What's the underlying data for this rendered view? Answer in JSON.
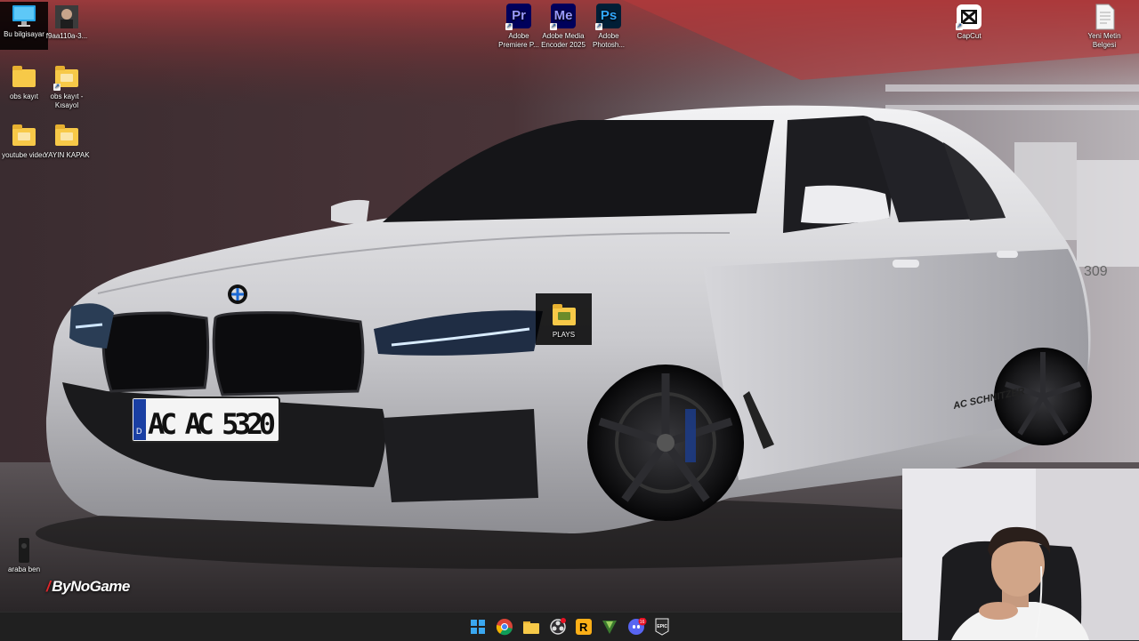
{
  "desktop": {
    "icons": [
      {
        "label": "Bu bilgisayar",
        "icon": "monitor-icon"
      },
      {
        "label": "f9aa110a-3...",
        "icon": "photo-icon"
      },
      {
        "label": "obs kayıt",
        "icon": "folder-icon"
      },
      {
        "label": "obs kayıt - Kısayol",
        "icon": "folder-shortcut-icon"
      },
      {
        "label": "youtube video",
        "icon": "folder-icon"
      },
      {
        "label": "YAYIN KAPAK",
        "icon": "folder-icon"
      },
      {
        "label": "Adobe Premiere P...",
        "icon": "premiere-icon",
        "tile": "Pr"
      },
      {
        "label": "Adobe Media Encoder 2025",
        "icon": "media-encoder-icon",
        "tile": "Me"
      },
      {
        "label": "Adobe Photosh...",
        "icon": "photoshop-icon",
        "tile": "Ps"
      },
      {
        "label": "CapCut",
        "icon": "capcut-icon"
      },
      {
        "label": "Yeni Metin Belgesi",
        "icon": "text-document-icon"
      },
      {
        "label": "PLAYS",
        "icon": "folder-icon"
      },
      {
        "label": "araba ben",
        "icon": "phone-video-icon"
      }
    ]
  },
  "watermark": {
    "text": "ByNoGame"
  },
  "wallpaper": {
    "plate": "AC AC 5320",
    "plate_country": "D",
    "badge": "AC SCHNITZER",
    "wall_number": "309"
  },
  "taskbar": {
    "items": [
      {
        "name": "start-button",
        "icon": "windows-icon"
      },
      {
        "name": "chrome-button",
        "icon": "chrome-icon"
      },
      {
        "name": "file-explorer-button",
        "icon": "folder-icon"
      },
      {
        "name": "obs-button",
        "icon": "obs-icon"
      },
      {
        "name": "rockstar-button",
        "icon": "rockstar-icon",
        "glyph": "R"
      },
      {
        "name": "vegas-button",
        "icon": "vegas-icon"
      },
      {
        "name": "discord-button",
        "icon": "discord-icon",
        "badge": "16"
      },
      {
        "name": "epic-games-button",
        "icon": "epic-games-icon",
        "glyph": "EPIC"
      }
    ]
  },
  "colors": {
    "taskbar_bg": "#202020",
    "selection_bg": "#000000",
    "folder": "#f7c948",
    "accent_red": "#e0262b"
  }
}
